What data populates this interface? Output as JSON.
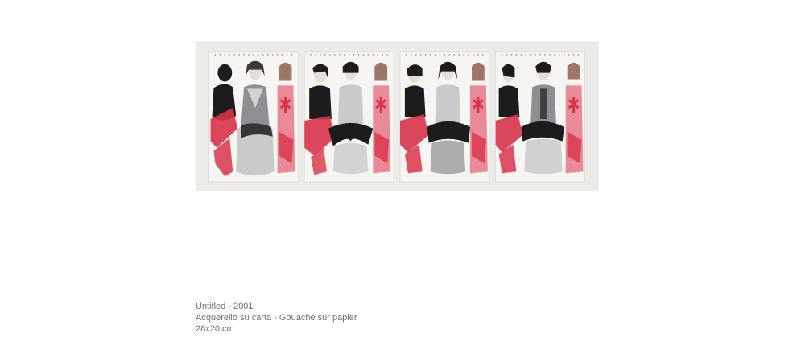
{
  "artwork": {
    "image": "four-panel-gouache-figures",
    "colors": {
      "mount": "#ecebe7",
      "paper": "#f6f5f2",
      "red": "#d9334a",
      "pink": "#e88a98",
      "black": "#1c1c1e",
      "grey": "#8d8f92",
      "light_grey": "#c9cacc",
      "skin": "#e9dcd3"
    }
  },
  "caption": {
    "title": "Untitled - 2001",
    "medium": "Acquerello su carta - Gouache sur papier",
    "dimensions": "28x20 cm"
  }
}
